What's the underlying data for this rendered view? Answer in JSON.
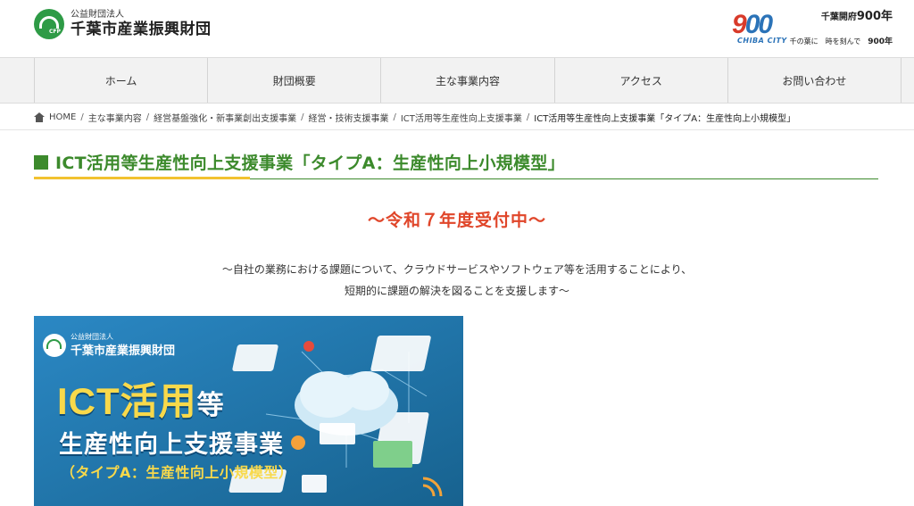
{
  "header": {
    "logo_sub": "公益財団法人",
    "logo_main": "千葉市産業振興財団",
    "logo_badge": "CFP",
    "anniv_number_1": "9",
    "anniv_number_2": "00",
    "anniv_city": "CHIBA CITY",
    "anniv_title_prefix": "千葉開府",
    "anniv_title_value": "900年",
    "anniv_slogan": "千の葉に　時を刻んで",
    "anniv_slogan_value": "900年"
  },
  "nav": {
    "items": [
      {
        "label": "ホーム"
      },
      {
        "label": "財団概要"
      },
      {
        "label": "主な事業内容"
      },
      {
        "label": "アクセス"
      },
      {
        "label": "お問い合わせ"
      }
    ]
  },
  "breadcrumb": {
    "home": "HOME",
    "items": [
      "主な事業内容",
      "経営基盤強化・新事業創出支援事業",
      "経営・技術支援事業",
      "ICT活用等生産性向上支援事業"
    ],
    "current": "ICT活用等生産性向上支援事業「タイプA：生産性向上小規模型」",
    "separator": "/"
  },
  "main": {
    "title": "ICT活用等生産性向上支援事業「タイプA：生産性向上小規模型」",
    "notice": "～令和７年度受付中～",
    "description_line1": "～自社の業務における課題について、クラウドサービスやソフトウェア等を活用することにより、",
    "description_line2": "短期的に課題の解決を図ることを支援します～"
  },
  "banner": {
    "logo_sub": "公益財団法人",
    "logo_main": "千葉市産業振興財団",
    "title_1": "ICT活用",
    "title_1_suffix": "等",
    "title_2": "生産性向上支援事業",
    "title_3": "（タイプA：生産性向上小規模型）"
  },
  "colors": {
    "title_green": "#3c8a2c",
    "accent_yellow": "#f2c230",
    "notice_red": "#e0462a",
    "banner_blue": "#1f78b0",
    "logo_green": "#2e9b46"
  }
}
